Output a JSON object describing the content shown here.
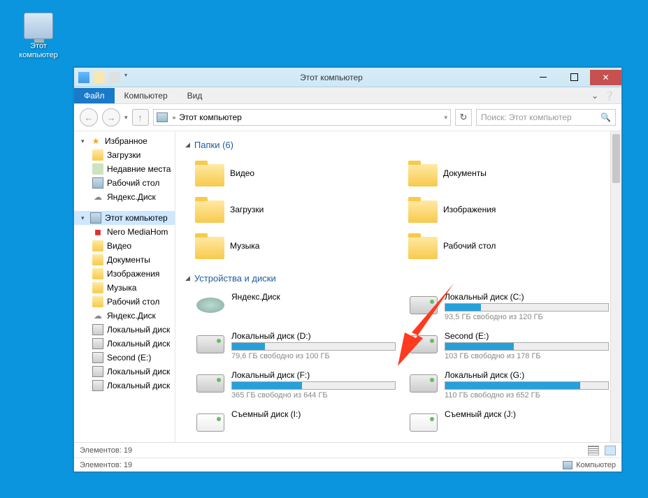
{
  "desktop": {
    "this_pc_label": "Этот\nкомпьютер"
  },
  "window": {
    "title": "Этот компьютер",
    "tabs": {
      "file": "Файл",
      "computer": "Компьютер",
      "view": "Вид"
    },
    "breadcrumb": {
      "location": "Этот компьютер"
    },
    "search": {
      "placeholder": "Поиск: Этот компьютер"
    }
  },
  "nav": {
    "favorites": "Избранное",
    "downloads": "Загрузки",
    "recent": "Недавние места",
    "desktop": "Рабочий стол",
    "yadisk": "Яндекс.Диск",
    "this_pc": "Этот компьютер",
    "nero": "Nero MediaHom",
    "video": "Видео",
    "documents": "Документы",
    "pictures": "Изображения",
    "music": "Музыка",
    "desktop2": "Рабочий стол",
    "yadisk2": "Яндекс.Диск",
    "localdisk": "Локальный диск",
    "localdisk2": "Локальный диск",
    "second": "Second (E:)",
    "localdisk3": "Локальный диск",
    "localdisk4": "Локальный диск"
  },
  "groups": {
    "folders_header": "Папки (6)",
    "devices_header": "Устройства и диски"
  },
  "folders": {
    "video": "Видео",
    "documents": "Документы",
    "downloads": "Загрузки",
    "pictures": "Изображения",
    "music": "Музыка",
    "desktop": "Рабочий стол"
  },
  "drives": {
    "yadisk": {
      "name": "Яндекс.Диск"
    },
    "c": {
      "name": "Локальный диск (C:)",
      "free": "93,5 ГБ свободно из 120 ГБ",
      "pct": 22
    },
    "d": {
      "name": "Локальный диск (D:)",
      "free": "79,6 ГБ свободно из 100 ГБ",
      "pct": 20
    },
    "e": {
      "name": "Second (E:)",
      "free": "103 ГБ свободно из 178 ГБ",
      "pct": 42
    },
    "f": {
      "name": "Локальный диск (F:)",
      "free": "365 ГБ свободно из 644 ГБ",
      "pct": 43
    },
    "g": {
      "name": "Локальный диск (G:)",
      "free": "110 ГБ свободно из 652 ГБ",
      "pct": 83
    },
    "i": {
      "name": "Съемный диск (I:)"
    },
    "j": {
      "name": "Съемный диск (J:)"
    }
  },
  "status": {
    "count": "Элементов: 19",
    "count2": "Элементов: 19",
    "computer": "Компьютер"
  }
}
